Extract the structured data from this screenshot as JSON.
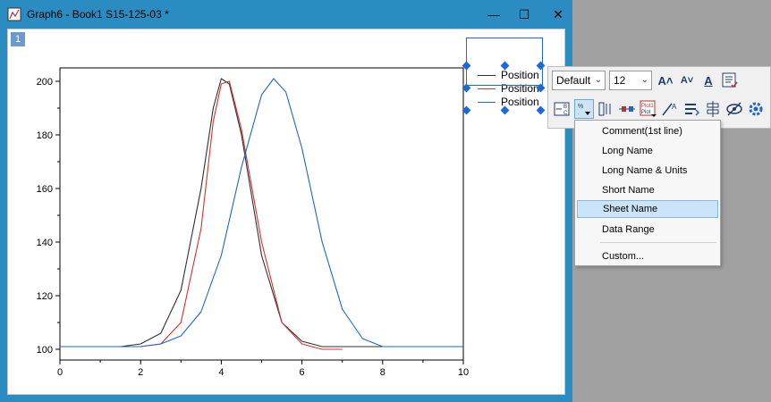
{
  "window": {
    "title": "Graph6 - Book1 S15-125-03 *",
    "minimize_glyph": "—",
    "maximize_glyph": "☐",
    "close_glyph": "✕"
  },
  "layer": {
    "tab_label": "1"
  },
  "legend": {
    "entries": [
      {
        "label": "Position",
        "color": "#303030"
      },
      {
        "label": "Position",
        "color": "#d43030"
      },
      {
        "label": "Position",
        "color": "#1e66c8"
      }
    ]
  },
  "toolbar": {
    "font_value": "Default",
    "size_value": "12",
    "icons": [
      "increase-font-icon",
      "decrease-font-icon",
      "font-color-icon",
      "legend-update-icon",
      "legend-columns-icon",
      "legend-text-icon",
      "legend-layout-icon",
      "legend-symbol-icon",
      "plot-label-icon",
      "text-slant-icon",
      "reverse-order-icon",
      "alignment-icon",
      "hide-icon",
      "settings-icon"
    ]
  },
  "menu": {
    "items": [
      {
        "label": "Comment(1st line)"
      },
      {
        "label": "Long Name"
      },
      {
        "label": "Long Name & Units"
      },
      {
        "label": "Short Name"
      },
      {
        "label": "Sheet Name",
        "selected": true
      },
      {
        "label": "Data Range"
      },
      {
        "label": "Custom..."
      }
    ]
  },
  "chart_data": {
    "type": "line",
    "title": "",
    "xlabel": "",
    "ylabel": "",
    "xlim": [
      0,
      10
    ],
    "ylim": [
      96,
      205
    ],
    "x_ticks": [
      0,
      2,
      4,
      6,
      8,
      10
    ],
    "y_ticks": [
      100,
      120,
      140,
      160,
      180,
      200
    ],
    "legend_position": "top-right outside",
    "series": [
      {
        "color": "#303030",
        "x": [
          0,
          1,
          1.5,
          2,
          2.5,
          3,
          3.5,
          3.8,
          4,
          4.2,
          4.5,
          5,
          5.5,
          6,
          6.5,
          7,
          8,
          9,
          10
        ],
        "y": [
          101,
          101,
          101,
          102,
          106,
          122,
          160,
          190,
          201,
          199,
          180,
          135,
          110,
          103,
          101,
          101,
          101,
          101,
          101
        ]
      },
      {
        "color": "#d43030",
        "x": [
          0,
          1,
          2,
          2.5,
          3,
          3.5,
          3.8,
          4,
          4.2,
          4.5,
          5,
          5.5,
          6,
          6.5,
          7
        ],
        "y": [
          101,
          101,
          101,
          102,
          110,
          145,
          185,
          199,
          200,
          182,
          140,
          110,
          102,
          100,
          100
        ]
      },
      {
        "color": "#1e66c8",
        "x": [
          0,
          1,
          2,
          2.5,
          3,
          3.5,
          4,
          4.5,
          5,
          5.3,
          5.6,
          6,
          6.5,
          7,
          7.5,
          8,
          9,
          10
        ],
        "y": [
          101,
          101,
          101,
          102,
          105,
          114,
          135,
          168,
          195,
          201,
          196,
          175,
          140,
          115,
          104,
          101,
          101,
          101
        ]
      }
    ]
  }
}
